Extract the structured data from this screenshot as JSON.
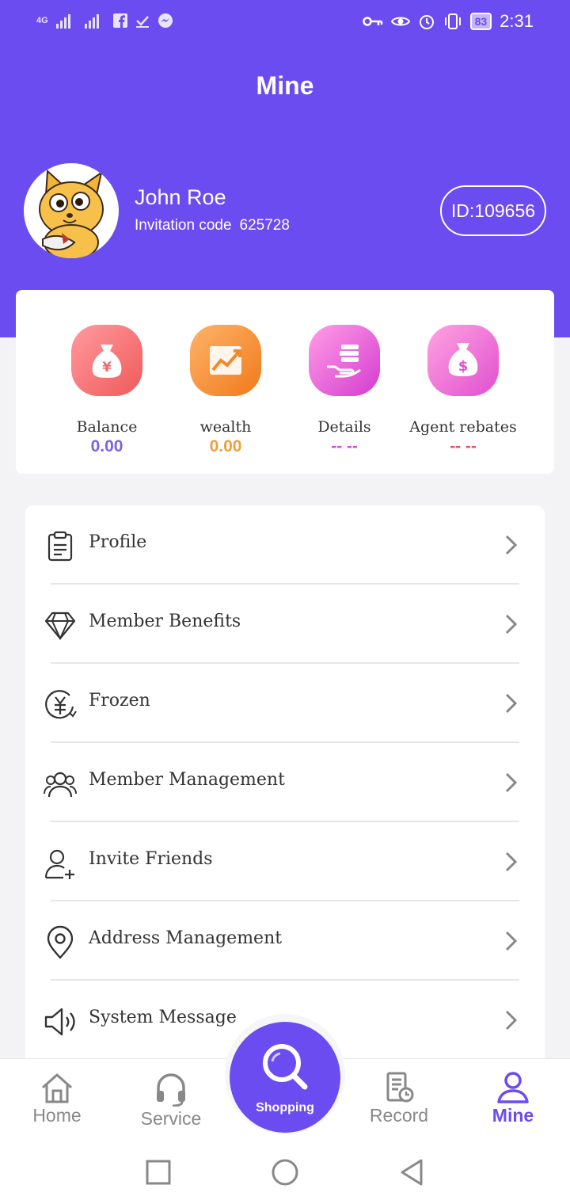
{
  "status_bar": {
    "network": "4G",
    "battery": "83",
    "time": "2:31"
  },
  "header": {
    "title": "Mine"
  },
  "user": {
    "name": "John Roe",
    "invitation_label": "Invitation code",
    "invitation_code": "625728",
    "id_badge": "ID:109656"
  },
  "stats": [
    {
      "label": "Balance",
      "value": "0.00",
      "value_color": "#7b61e8",
      "icon": "money-bag-yen-icon"
    },
    {
      "label": "wealth",
      "value": "0.00",
      "value_color": "#f0a03a",
      "icon": "growth-chart-icon"
    },
    {
      "label": "Details",
      "value": "-- --",
      "value_color": "#d24fd8",
      "icon": "coins-hand-icon"
    },
    {
      "label": "Agent rebates",
      "value": "-- --",
      "value_color": "#e8506a",
      "icon": "money-bag-dollar-icon"
    }
  ],
  "menu": [
    {
      "label": "Profile",
      "icon": "clipboard-icon"
    },
    {
      "label": "Member Benefits",
      "icon": "diamond-icon"
    },
    {
      "label": "Frozen",
      "icon": "frozen-yen-icon"
    },
    {
      "label": "Member Management",
      "icon": "users-icon"
    },
    {
      "label": "Invite Friends",
      "icon": "user-add-icon"
    },
    {
      "label": "Address Management",
      "icon": "location-pin-icon"
    },
    {
      "label": "System Message",
      "icon": "speaker-icon"
    }
  ],
  "tabs": [
    {
      "label": "Home",
      "icon": "home-icon"
    },
    {
      "label": "Service",
      "icon": "headset-icon"
    },
    {
      "label": "Shopping",
      "icon": "search-icon"
    },
    {
      "label": "Record",
      "icon": "record-icon"
    },
    {
      "label": "Mine",
      "icon": "user-icon",
      "active": true
    }
  ],
  "colors": {
    "primary": "#6a4cf0"
  }
}
